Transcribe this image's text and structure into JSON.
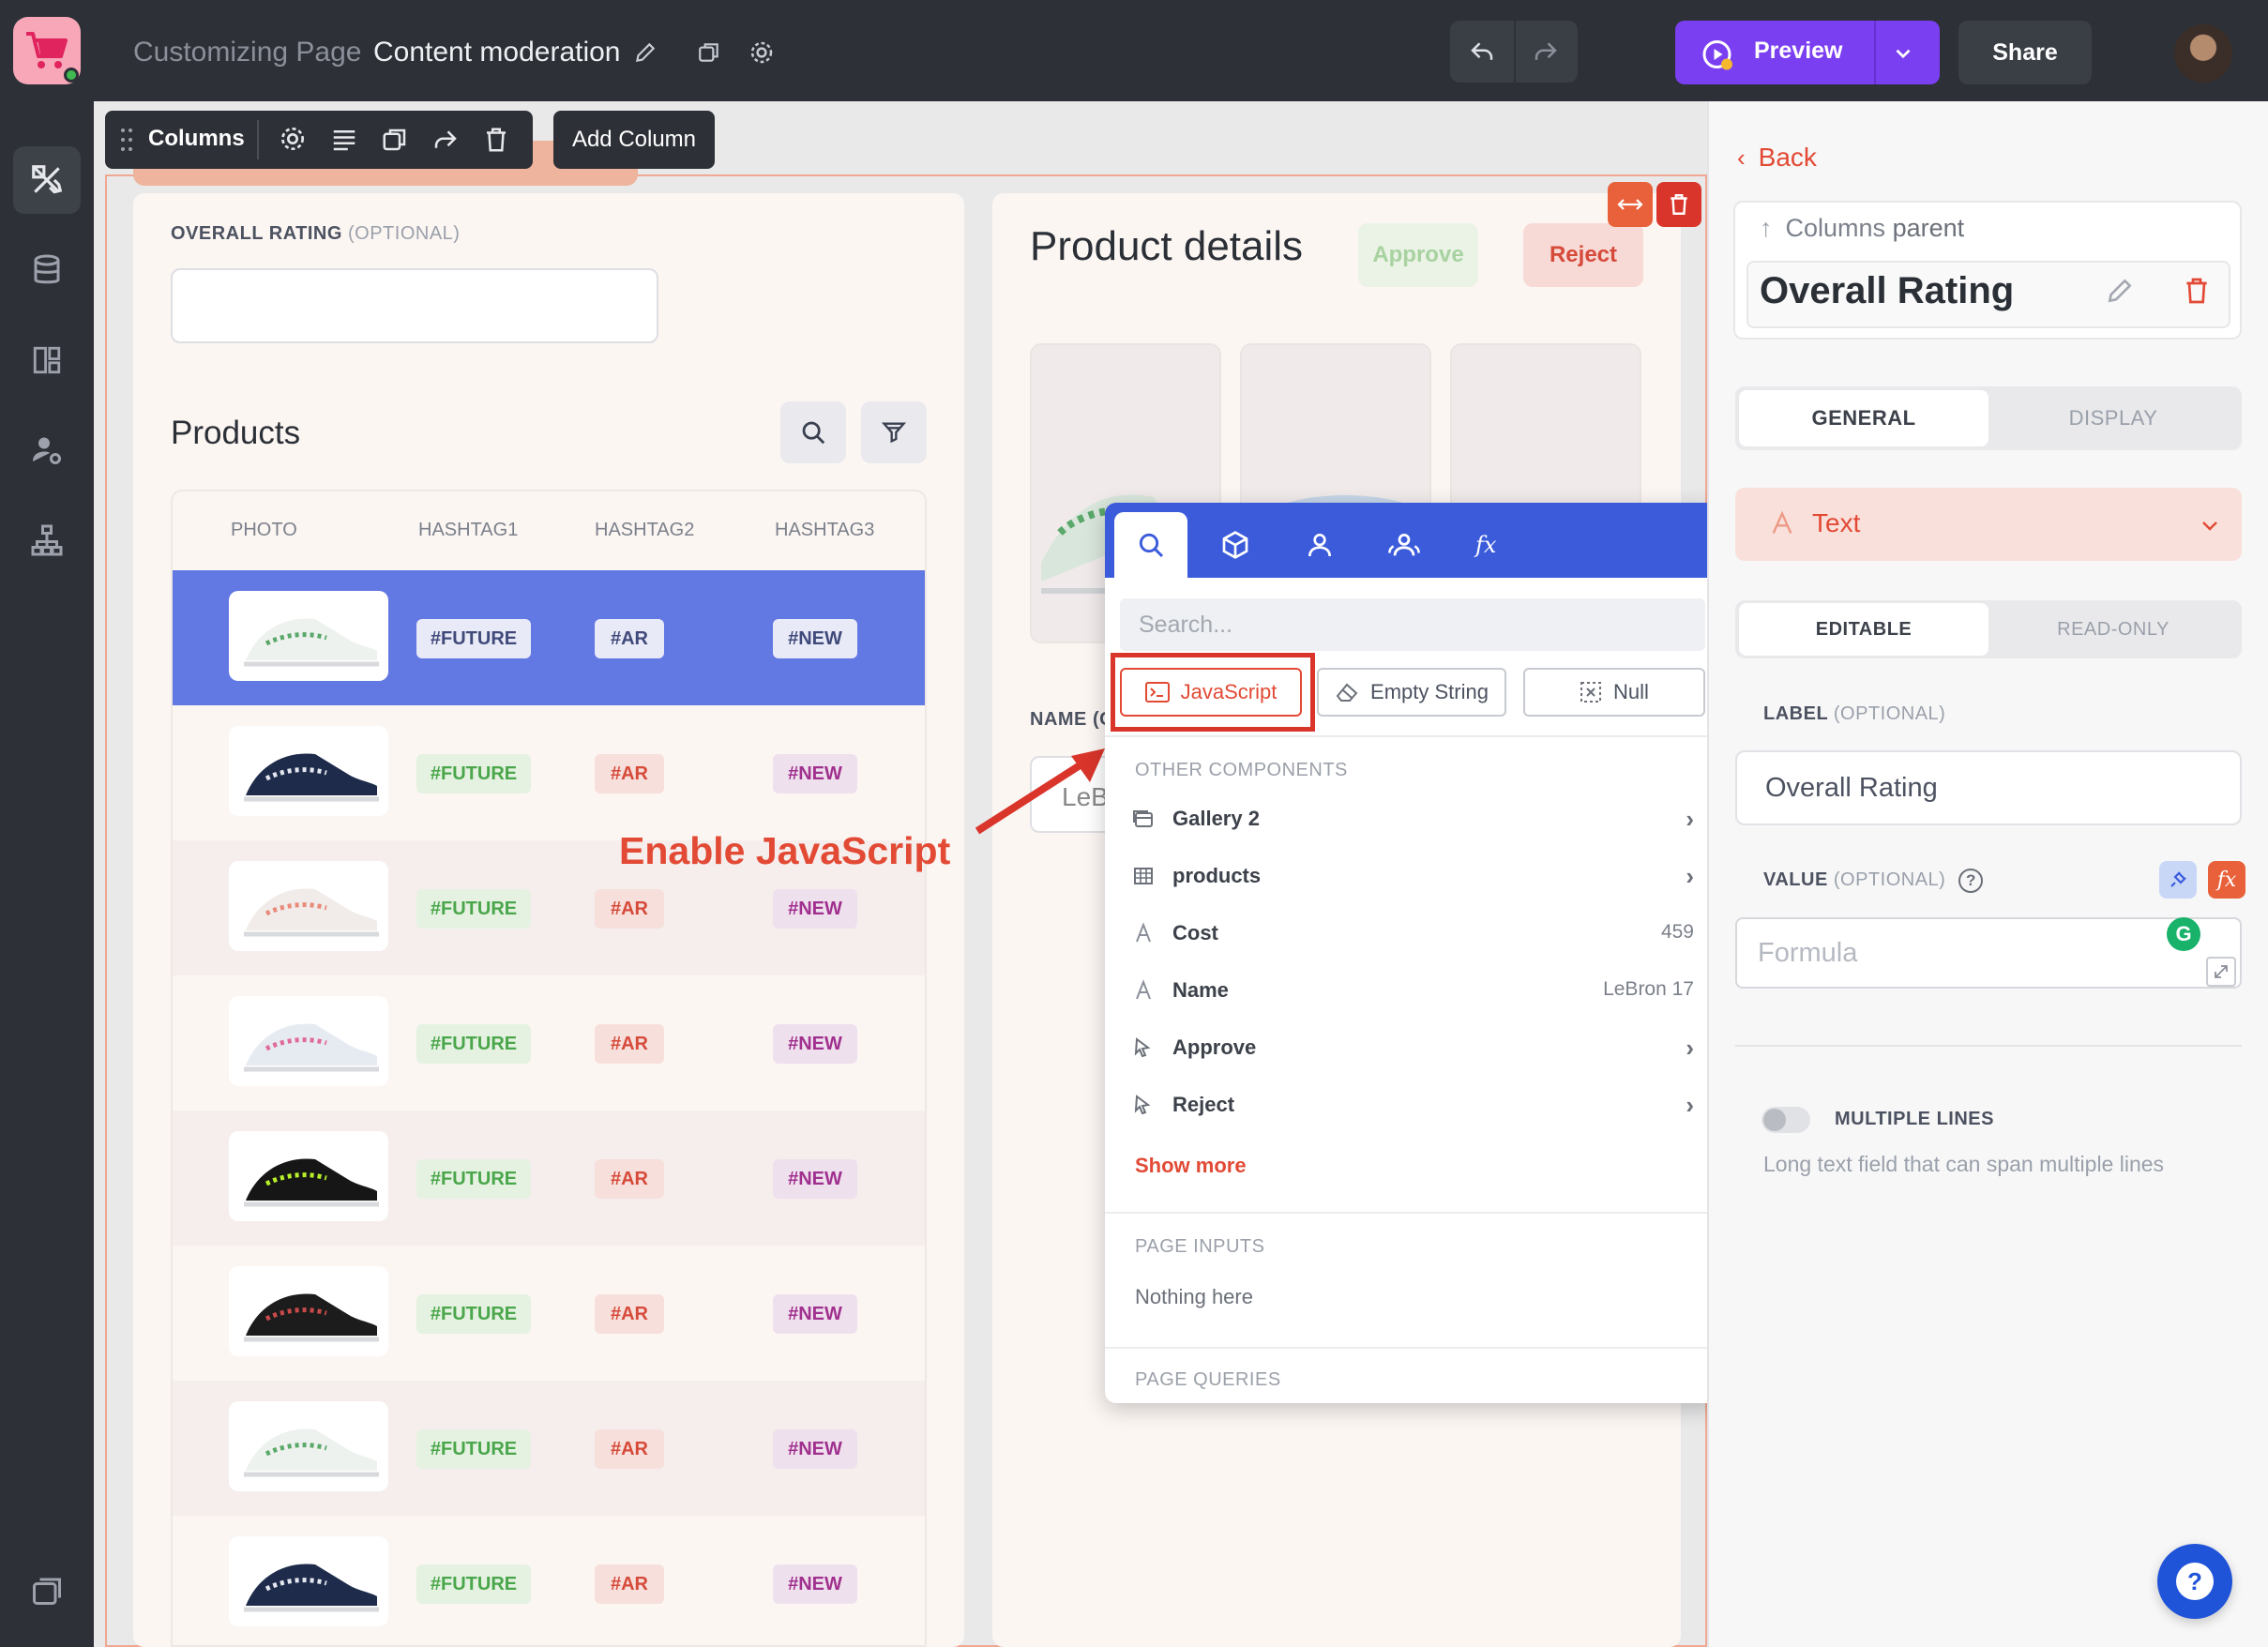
{
  "header": {
    "parent_crumb": "Customizing Page",
    "page_name": "Content moderation",
    "preview_label": "Preview",
    "share_label": "Share"
  },
  "sidebar": {
    "items": [
      {
        "name": "design",
        "icon": "design-icon"
      },
      {
        "name": "data",
        "icon": "database-icon"
      },
      {
        "name": "layout",
        "icon": "layout-icon"
      },
      {
        "name": "users",
        "icon": "user-settings-icon"
      },
      {
        "name": "hierarchy",
        "icon": "sitemap-icon"
      },
      {
        "name": "pages",
        "icon": "pages-icon"
      }
    ]
  },
  "column_toolbar": {
    "name": "Columns",
    "add_column_label": "Add Column"
  },
  "left_card": {
    "rating_label": "OVERALL RATING",
    "rating_optional": "(OPTIONAL)",
    "products_title": "Products",
    "table": {
      "columns": [
        "PHOTO",
        "HASHTAG1",
        "HASHTAG2",
        "HASHTAG3"
      ],
      "rows": [
        {
          "h1": "#FUTURE",
          "h2": "#AR",
          "h3": "#NEW",
          "selected": true
        },
        {
          "h1": "#FUTURE",
          "h2": "#AR",
          "h3": "#NEW"
        },
        {
          "h1": "#FUTURE",
          "h2": "#AR",
          "h3": "#NEW"
        },
        {
          "h1": "#FUTURE",
          "h2": "#AR",
          "h3": "#NEW"
        },
        {
          "h1": "#FUTURE",
          "h2": "#AR",
          "h3": "#NEW"
        },
        {
          "h1": "#FUTURE",
          "h2": "#AR",
          "h3": "#NEW"
        },
        {
          "h1": "#FUTURE",
          "h2": "#AR",
          "h3": "#NEW"
        },
        {
          "h1": "#FUTURE",
          "h2": "#AR",
          "h3": "#NEW"
        }
      ]
    }
  },
  "right_card": {
    "title": "Product details",
    "approve_label": "Approve",
    "reject_label": "Reject",
    "name_label": "NAME (C",
    "name_value": "LeB"
  },
  "annotation": {
    "text": "Enable JavaScript"
  },
  "popup": {
    "search_placeholder": "Search...",
    "chips": {
      "javascript": "JavaScript",
      "empty_string": "Empty String",
      "null": "Null"
    },
    "other_components_title": "OTHER COMPONENTS",
    "items": [
      {
        "label": "Gallery 2",
        "icon": "gallery-icon",
        "value": "",
        "chevron": true
      },
      {
        "label": "products",
        "icon": "table-icon",
        "value": "",
        "chevron": true
      },
      {
        "label": "Cost",
        "icon": "text-icon",
        "value": "459",
        "chevron": false
      },
      {
        "label": "Name",
        "icon": "text-icon",
        "value": "LeBron 17",
        "chevron": false
      },
      {
        "label": "Approve",
        "icon": "cursor-icon",
        "value": "",
        "chevron": true
      },
      {
        "label": "Reject",
        "icon": "cursor-icon",
        "value": "",
        "chevron": true
      }
    ],
    "show_more": "Show more",
    "page_inputs_title": "PAGE INPUTS",
    "nothing_here": "Nothing here",
    "page_queries_title": "PAGE QUERIES"
  },
  "panel": {
    "back_label": "Back",
    "parent_label": "Columns",
    "parent_suffix": "parent",
    "component_name": "Overall Rating",
    "tabs": [
      "GENERAL",
      "DISPLAY"
    ],
    "type_label": "Text",
    "mode_tabs": [
      "EDITABLE",
      "READ-ONLY"
    ],
    "label_field_label": "LABEL",
    "label_field_optional": "(OPTIONAL)",
    "label_value": "Overall Rating",
    "value_field_label": "VALUE",
    "value_field_optional": "(OPTIONAL)",
    "formula_placeholder": "Formula",
    "grammarly_letter": "G",
    "multiple_lines_label": "MULTIPLE LINES",
    "multiple_lines_desc": "Long text field that can span multiple lines"
  },
  "colors": {
    "accent": "#e24a35",
    "preview": "#7b3ff2",
    "popup_tab_bar": "#3b5bdb",
    "selected_row": "#6278e3"
  }
}
